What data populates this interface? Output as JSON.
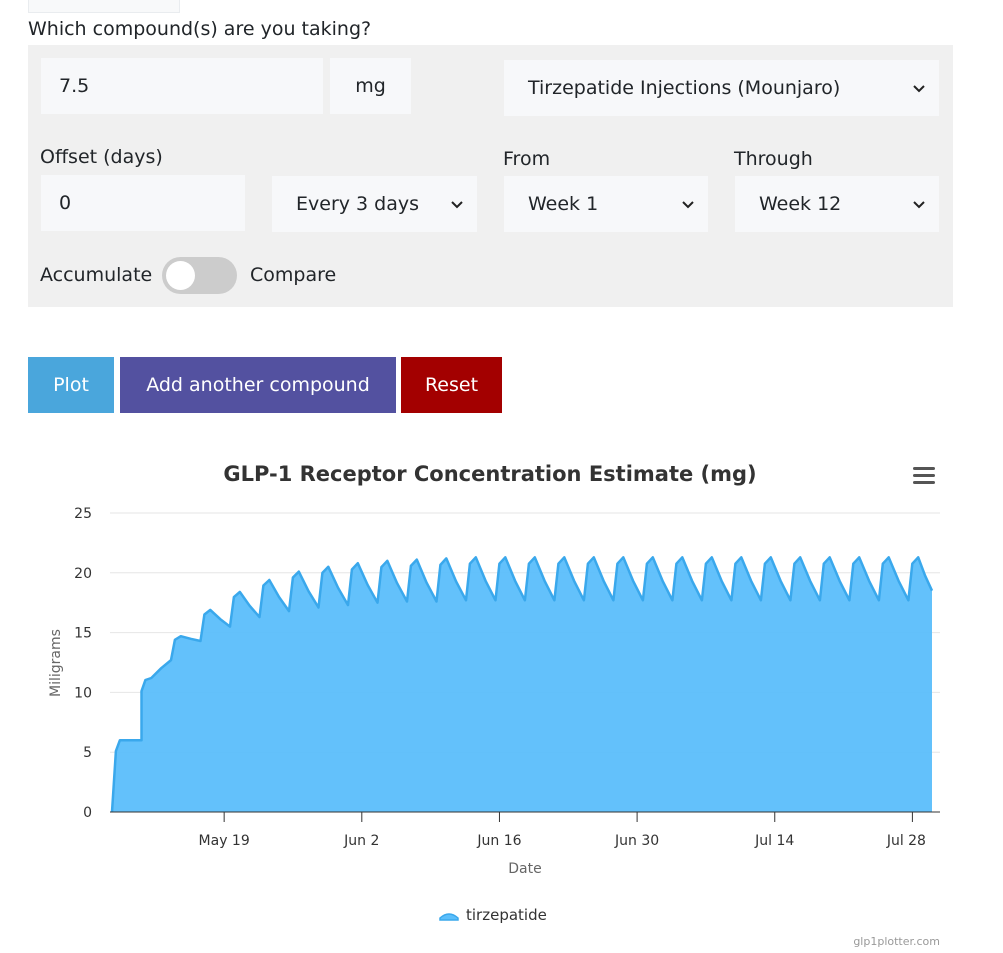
{
  "form": {
    "question": "Which compound(s) are you taking?",
    "dose_value": "7.5",
    "dose_unit": "mg",
    "compound_selected": "Tirzepatide Injections (Mounjaro)",
    "offset_label": "Offset (days)",
    "offset_value": "0",
    "frequency_selected": "Every 3 days",
    "from_label": "From",
    "from_selected": "Week 1",
    "through_label": "Through",
    "through_selected": "Week 12",
    "accumulate_label": "Accumulate",
    "compare_label": "Compare",
    "toggle_on": false
  },
  "buttons": {
    "plot": "Plot",
    "add_compound": "Add another compound",
    "reset": "Reset"
  },
  "colors": {
    "plot_button": "#4aa6dc",
    "add_button": "#5351a0",
    "reset_button": "#a30000",
    "series_fill": "#5bbefb",
    "series_line": "#3aa8ec"
  },
  "chart_data": {
    "type": "area",
    "title": "GLP-1 Receptor Concentration Estimate (mg)",
    "xlabel": "Date",
    "ylabel": "Miligrams",
    "ylim": [
      0,
      25
    ],
    "y_ticks": [
      0,
      5,
      10,
      15,
      20,
      25
    ],
    "x_ticks": [
      "May 19",
      "Jun 2",
      "Jun 16",
      "Jun 30",
      "Jul 14",
      "Jul 28"
    ],
    "grid": true,
    "legend_position": "bottom-center",
    "credits": "glp1plotter.com",
    "series": [
      {
        "name": "tirzepatide",
        "dose_days": [
          0,
          3,
          6,
          9,
          12,
          15,
          18,
          21,
          24,
          27,
          30,
          33,
          36,
          39,
          42,
          45,
          48,
          51,
          54,
          57,
          60,
          63,
          66,
          69,
          72,
          75,
          78,
          81
        ],
        "peaks": [
          6.0,
          11.2,
          14.7,
          16.9,
          18.4,
          19.4,
          20.1,
          20.5,
          20.8,
          21.0,
          21.1,
          21.2,
          21.3,
          21.3,
          21.3,
          21.3,
          21.3,
          21.3,
          21.3,
          21.3,
          21.3,
          21.3,
          21.3,
          21.3,
          21.3,
          21.3,
          21.3,
          21.3
        ],
        "troughs": [
          6.0,
          10.1,
          12.7,
          14.3,
          15.5,
          16.3,
          16.8,
          17.1,
          17.3,
          17.5,
          17.6,
          17.6,
          17.7,
          17.7,
          17.7,
          17.7,
          17.7,
          17.7,
          17.7,
          17.7,
          17.7,
          17.7,
          17.7,
          17.7,
          17.7,
          17.7,
          17.7,
          17.7
        ],
        "end_day": 83.4,
        "end_value": 18.5
      }
    ]
  }
}
